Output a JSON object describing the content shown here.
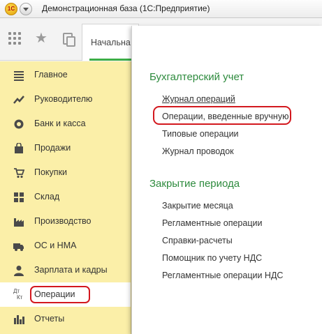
{
  "window": {
    "logo_text": "1С",
    "title": "Демонстрационная база (1С:Предприятие)"
  },
  "toolbar": {
    "icons": [
      "apps-grid-icon",
      "star-icon",
      "history-icon"
    ],
    "start_tab": "Начальна"
  },
  "sidebar": {
    "items": [
      {
        "label": "Главное",
        "icon": "list-icon",
        "active": false
      },
      {
        "label": "Руководителю",
        "icon": "trend-icon",
        "active": false
      },
      {
        "label": "Банк и касса",
        "icon": "coins-icon",
        "active": false
      },
      {
        "label": "Продажи",
        "icon": "bag-icon",
        "active": false
      },
      {
        "label": "Покупки",
        "icon": "cart-icon",
        "active": false
      },
      {
        "label": "Склад",
        "icon": "warehouse-icon",
        "active": false
      },
      {
        "label": "Производство",
        "icon": "factory-icon",
        "active": false
      },
      {
        "label": "ОС и НМА",
        "icon": "truck-icon",
        "active": false
      },
      {
        "label": "Зарплата и кадры",
        "icon": "person-icon",
        "active": false
      },
      {
        "label": "Операции",
        "icon": "dt-kt-icon",
        "active": true
      },
      {
        "label": "Отчеты",
        "icon": "bar-chart-icon",
        "active": false
      }
    ],
    "dt_kt_icon_text": {
      "dt": "Дт",
      "kt": "Кт"
    }
  },
  "panel": {
    "sections": [
      {
        "title": "Бухгалтерский учет",
        "links": [
          "Журнал операций",
          "Операции, введенные вручную",
          "Типовые операции",
          "Журнал проводок"
        ]
      },
      {
        "title": "Закрытие периода",
        "links": [
          "Закрытие месяца",
          "Регламентные операции",
          "Справки-расчеты",
          "Помощник по учету НДС",
          "Регламентные операции НДС"
        ]
      }
    ]
  },
  "annotation_color": "#d3181e",
  "accent_color": "#2e8b3e",
  "sidebar_color": "#fbefa8"
}
